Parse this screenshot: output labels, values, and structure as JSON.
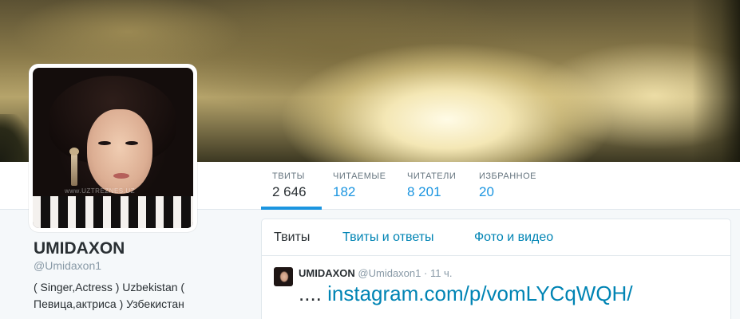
{
  "profile": {
    "name": "UMIDAXON",
    "handle": "@Umidaxon1",
    "bio": "( Singer,Actress ) Uzbekistan ( Певица,актриса ) Узбекистан",
    "avatar_watermark": "www.UZTREZNES.UZ"
  },
  "stats": [
    {
      "label": "ТВИТЫ",
      "value": "2 646"
    },
    {
      "label": "ЧИТАЕМЫЕ",
      "value": "182"
    },
    {
      "label": "ЧИТАТЕЛИ",
      "value": "8 201"
    },
    {
      "label": "ИЗБРАННОЕ",
      "value": "20"
    }
  ],
  "tabs": [
    {
      "label": "Твиты"
    },
    {
      "label": "Твиты и ответы"
    },
    {
      "label": "Фото и видео"
    }
  ],
  "tweet": {
    "name": "UMIDAXON",
    "handle": "@Umidaxon1",
    "separator": "·",
    "time": "11 ч.",
    "prefix": "....",
    "link": "instagram.com/p/vomLYCqWQH/"
  },
  "colors": {
    "accent": "#1b95e0",
    "link": "#0084b4",
    "text": "#292f33",
    "muted": "#8899a6"
  }
}
